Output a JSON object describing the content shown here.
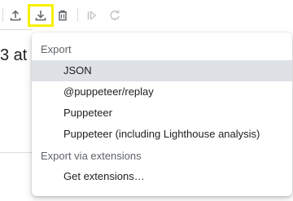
{
  "toolbar": {
    "icons": [
      "upload-icon",
      "download-icon",
      "trash-icon",
      "step-play-icon",
      "redo-icon"
    ]
  },
  "background": {
    "title_fragment": "3 at"
  },
  "menu": {
    "export_heading": "Export",
    "items": [
      {
        "label": "JSON",
        "selected": true
      },
      {
        "label": "@puppeteer/replay"
      },
      {
        "label": "Puppeteer"
      },
      {
        "label": "Puppeteer (including Lighthouse analysis)"
      }
    ],
    "extensions_heading": "Export via extensions",
    "get_extensions_label": "Get extensions…"
  },
  "colors": {
    "highlight": "#f6f000",
    "selected_bg": "#dee1e6"
  }
}
